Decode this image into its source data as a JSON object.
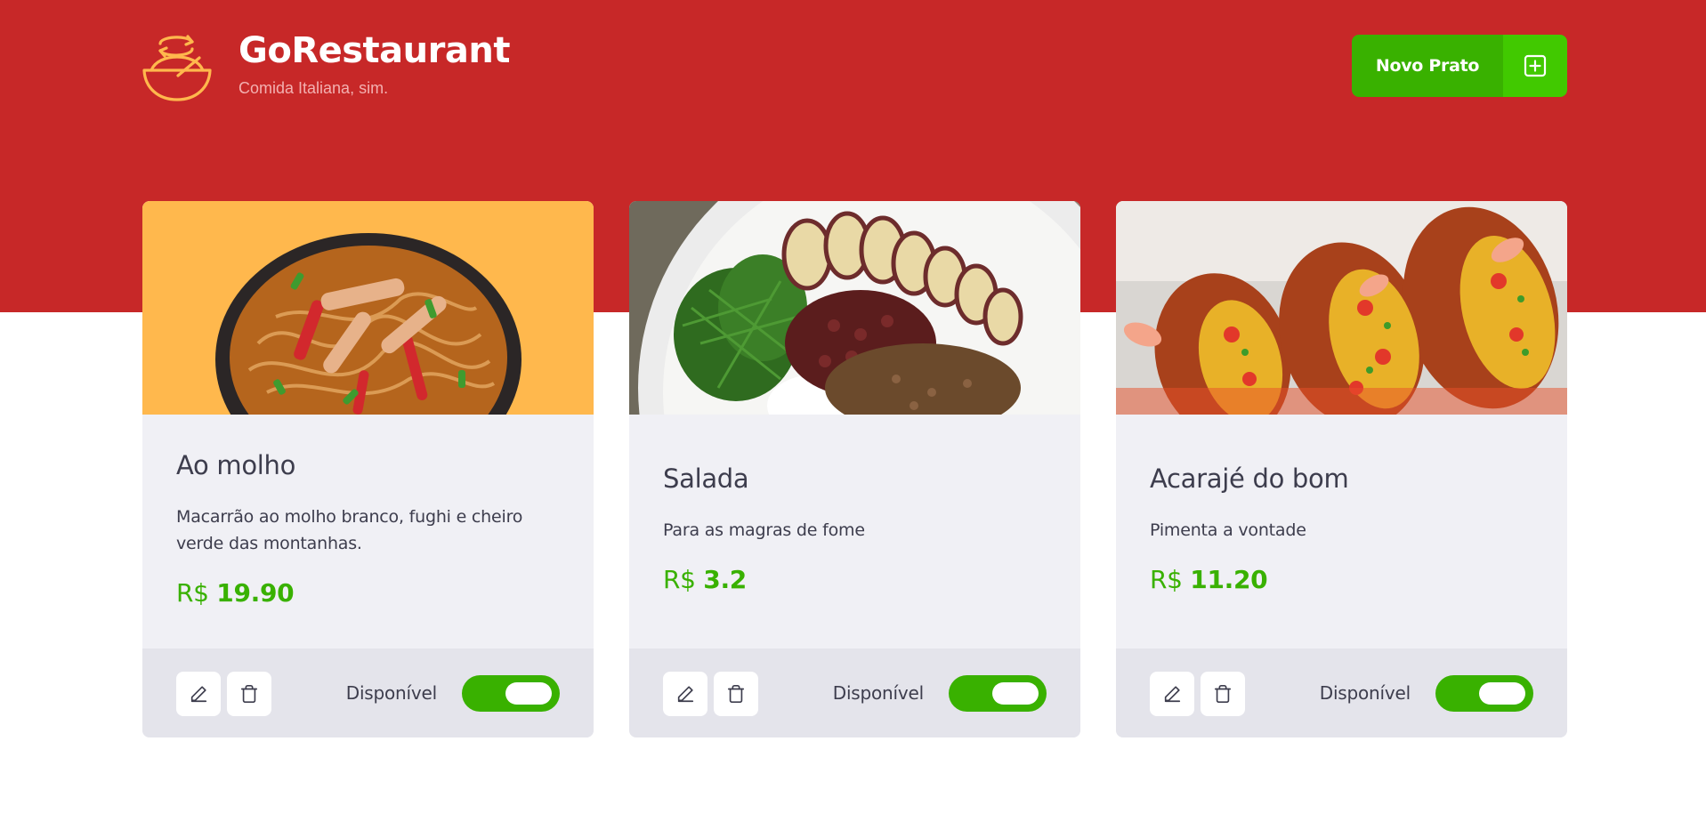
{
  "header": {
    "title": "GoRestaurant",
    "subtitle": "Comida Italiana, sim.",
    "new_button_label": "Novo Prato"
  },
  "colors": {
    "header_red": "#c72828",
    "accent_green": "#39b100",
    "accent_green_light": "#41c900",
    "text_dark": "#3d3d4d",
    "card_bg": "#f0f0f5",
    "card_footer_bg": "#e4e4eb"
  },
  "icons": [
    "bowl-logo-icon",
    "plus-square-icon",
    "pencil-icon",
    "trash-icon"
  ],
  "dishes": [
    {
      "name": "Ao molho",
      "description": "Macarrão ao molho branco, fughi e cheiro verde das montanhas.",
      "currency": "R$",
      "price": "19.90",
      "available_label": "Disponível",
      "available": true
    },
    {
      "name": "Salada",
      "description": "Para as magras de fome",
      "currency": "R$",
      "price": "3.2",
      "available_label": "Disponível",
      "available": true
    },
    {
      "name": "Acarajé do bom",
      "description": "Pimenta a vontade",
      "currency": "R$",
      "price": "11.20",
      "available_label": "Disponível",
      "available": true
    }
  ]
}
